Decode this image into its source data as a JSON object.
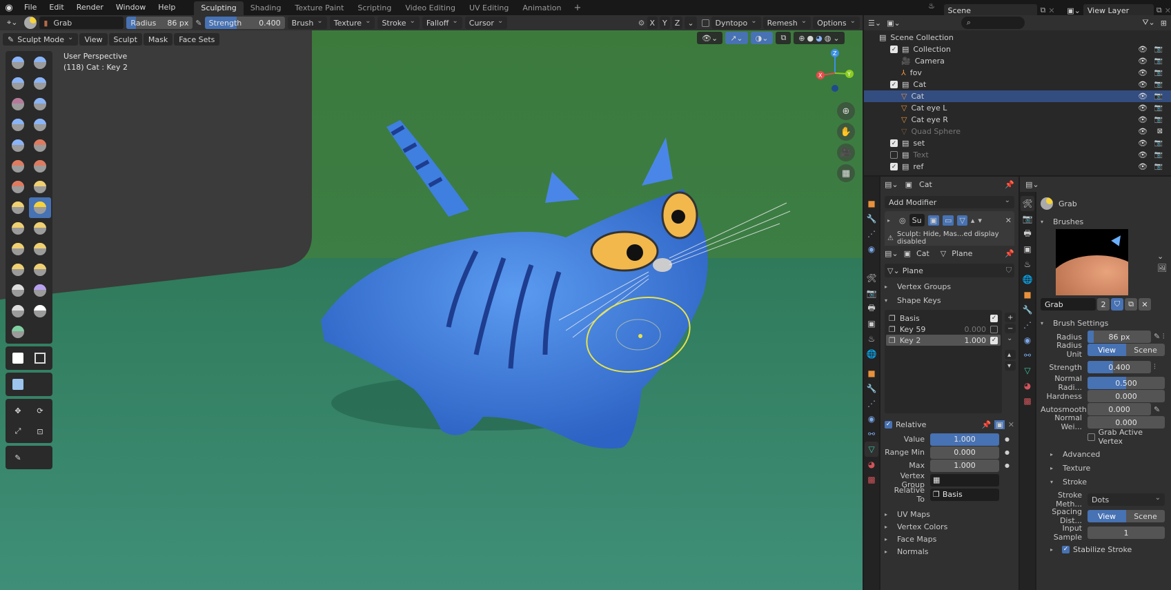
{
  "menubar": {
    "items": [
      "File",
      "Edit",
      "Render",
      "Window",
      "Help"
    ],
    "workspaces": [
      "Sculpting",
      "Shading",
      "Texture Paint",
      "Scripting",
      "Video Editing",
      "UV Editing",
      "Animation"
    ],
    "active_workspace": "Sculpting",
    "add_workspace": "+",
    "scene": "Scene",
    "view_layer": "View Layer"
  },
  "toolheader": {
    "brush_name": "Grab",
    "radius_label": "Radius",
    "radius_value": "86 px",
    "strength_label": "Strength",
    "strength_value": "0.400",
    "strength_fraction": 0.4,
    "menus": [
      "Brush",
      "Texture",
      "Stroke",
      "Falloff",
      "Cursor"
    ],
    "symmetry": [
      "X",
      "Y",
      "Z"
    ],
    "dyntopo": "Dyntopo",
    "remesh": "Remesh",
    "options": "Options"
  },
  "viewport_header": {
    "mode": "Sculpt Mode",
    "menus": [
      "View",
      "Sculpt",
      "Mask",
      "Face Sets"
    ]
  },
  "viewport": {
    "perspective": "User Perspective",
    "object_info": "(118) Cat : Key 2",
    "gizmo_axes": [
      "X",
      "Y",
      "Z"
    ]
  },
  "outliner": {
    "search_placeholder": "",
    "root": "Scene Collection",
    "rows": [
      {
        "name": "Collection",
        "type": "collection",
        "checked": true
      },
      {
        "name": "Camera",
        "type": "camera"
      },
      {
        "name": "fov",
        "type": "empty"
      },
      {
        "name": "Cat",
        "type": "collection",
        "checked": true
      },
      {
        "name": "Cat",
        "type": "mesh",
        "selected": true
      },
      {
        "name": "Cat eye L",
        "type": "mesh"
      },
      {
        "name": "Cat eye R",
        "type": "mesh"
      },
      {
        "name": "Quad Sphere",
        "type": "mesh",
        "disabled": true
      },
      {
        "name": "set",
        "type": "collection",
        "checked": true
      },
      {
        "name": "Text",
        "type": "collection",
        "checked": false
      },
      {
        "name": "ref",
        "type": "collection",
        "checked": true
      }
    ]
  },
  "modifier_panel": {
    "object": "Cat",
    "add_modifier": "Add Modifier",
    "modifier_short": "Su",
    "warning": "Sculpt: Hide, Mas...ed display disabled"
  },
  "data_panel": {
    "object": "Cat",
    "mesh": "Plane",
    "mesh_field": "Plane",
    "sections": {
      "vertex_groups": "Vertex Groups",
      "shape_keys": "Shape Keys",
      "uv_maps": "UV Maps",
      "vertex_colors": "Vertex Colors",
      "face_maps": "Face Maps",
      "normals": "Normals"
    },
    "shape_keys": [
      {
        "name": "Basis",
        "value": "",
        "checked": true
      },
      {
        "name": "Key 59",
        "value": "0.000",
        "checked": false
      },
      {
        "name": "Key 2",
        "value": "1.000",
        "checked": true,
        "active": true
      }
    ],
    "relative_label": "Relative",
    "value_label": "Value",
    "value": "1.000",
    "value_fraction": 1.0,
    "range_min_label": "Range Min",
    "range_min": "0.000",
    "max_label": "Max",
    "max": "1.000",
    "vertex_group_label": "Vertex Group",
    "vertex_group": "",
    "relative_to_label": "Relative To",
    "relative_to": "Basis"
  },
  "tool_panel": {
    "tool_name": "Grab",
    "brushes_label": "Brushes",
    "brush_field": "Grab",
    "brush_users": "2",
    "brush_settings_label": "Brush Settings",
    "radius_label": "Radius",
    "radius": "86 px",
    "radius_unit_label": "Radius Unit",
    "unit_view": "View",
    "unit_scene": "Scene",
    "strength_label": "Strength",
    "strength": "0.400",
    "strength_fraction": 0.4,
    "normal_radius_label": "Normal Radi...",
    "normal_radius": "0.500",
    "normal_radius_fraction": 0.5,
    "hardness_label": "Hardness",
    "hardness": "0.000",
    "autosmooth_label": "Autosmooth",
    "autosmooth": "0.000",
    "normal_weight_label": "Normal Wei...",
    "normal_weight": "0.000",
    "grab_active_vertex": "Grab Active Vertex",
    "advanced": "Advanced",
    "texture": "Texture",
    "stroke": "Stroke",
    "stroke_method_label": "Stroke Meth...",
    "stroke_method": "Dots",
    "spacing_label": "Spacing Dist...",
    "spacing_view": "View",
    "spacing_scene": "Scene",
    "input_sample_label": "Input Sample",
    "input_sample": "1",
    "stabilize": "Stabilize Stroke"
  },
  "colors": {
    "accent": "#4772b3",
    "selection": "#334d80",
    "viewport_bg": "#3d7d47",
    "cat_blue": "#3b7de0"
  }
}
